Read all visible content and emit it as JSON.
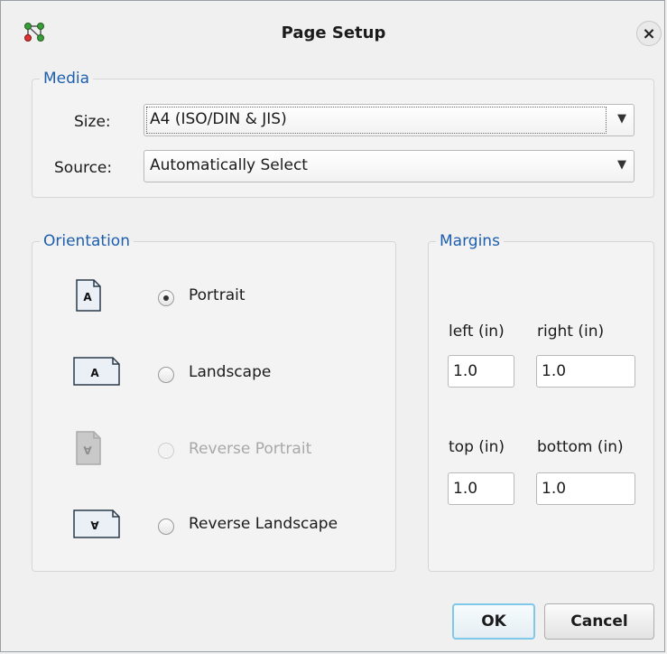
{
  "dialog": {
    "title": "Page Setup",
    "close_label": "×",
    "app_icon": "network-nodes-icon"
  },
  "media": {
    "legend": "Media",
    "size_label": "Size:",
    "size_value": "A4 (ISO/DIN & JIS)",
    "source_label": "Source:",
    "source_value": "Automatically Select",
    "dropdown_arrow": "▼"
  },
  "orientation": {
    "legend": "Orientation",
    "options": [
      {
        "label": "Portrait",
        "icon_glyph": "A",
        "checked": true,
        "enabled": true
      },
      {
        "label": "Landscape",
        "icon_glyph": "A",
        "checked": false,
        "enabled": true
      },
      {
        "label": "Reverse Portrait",
        "icon_glyph": "∀",
        "checked": false,
        "enabled": false
      },
      {
        "label": "Reverse Landscape",
        "icon_glyph": "∀",
        "checked": false,
        "enabled": true
      }
    ]
  },
  "margins": {
    "legend": "Margins",
    "left_label": "left (in)",
    "left_value": "1.0",
    "right_label": "right (in)",
    "right_value": "1.0",
    "top_label": "top (in)",
    "top_value": "1.0",
    "bottom_label": "bottom (in)",
    "bottom_value": "1.0"
  },
  "buttons": {
    "ok": "OK",
    "cancel": "Cancel"
  },
  "colors": {
    "legend": "#1d5fae",
    "ok_border": "#7fc8ea",
    "disabled_text": "#a8a8a8"
  }
}
